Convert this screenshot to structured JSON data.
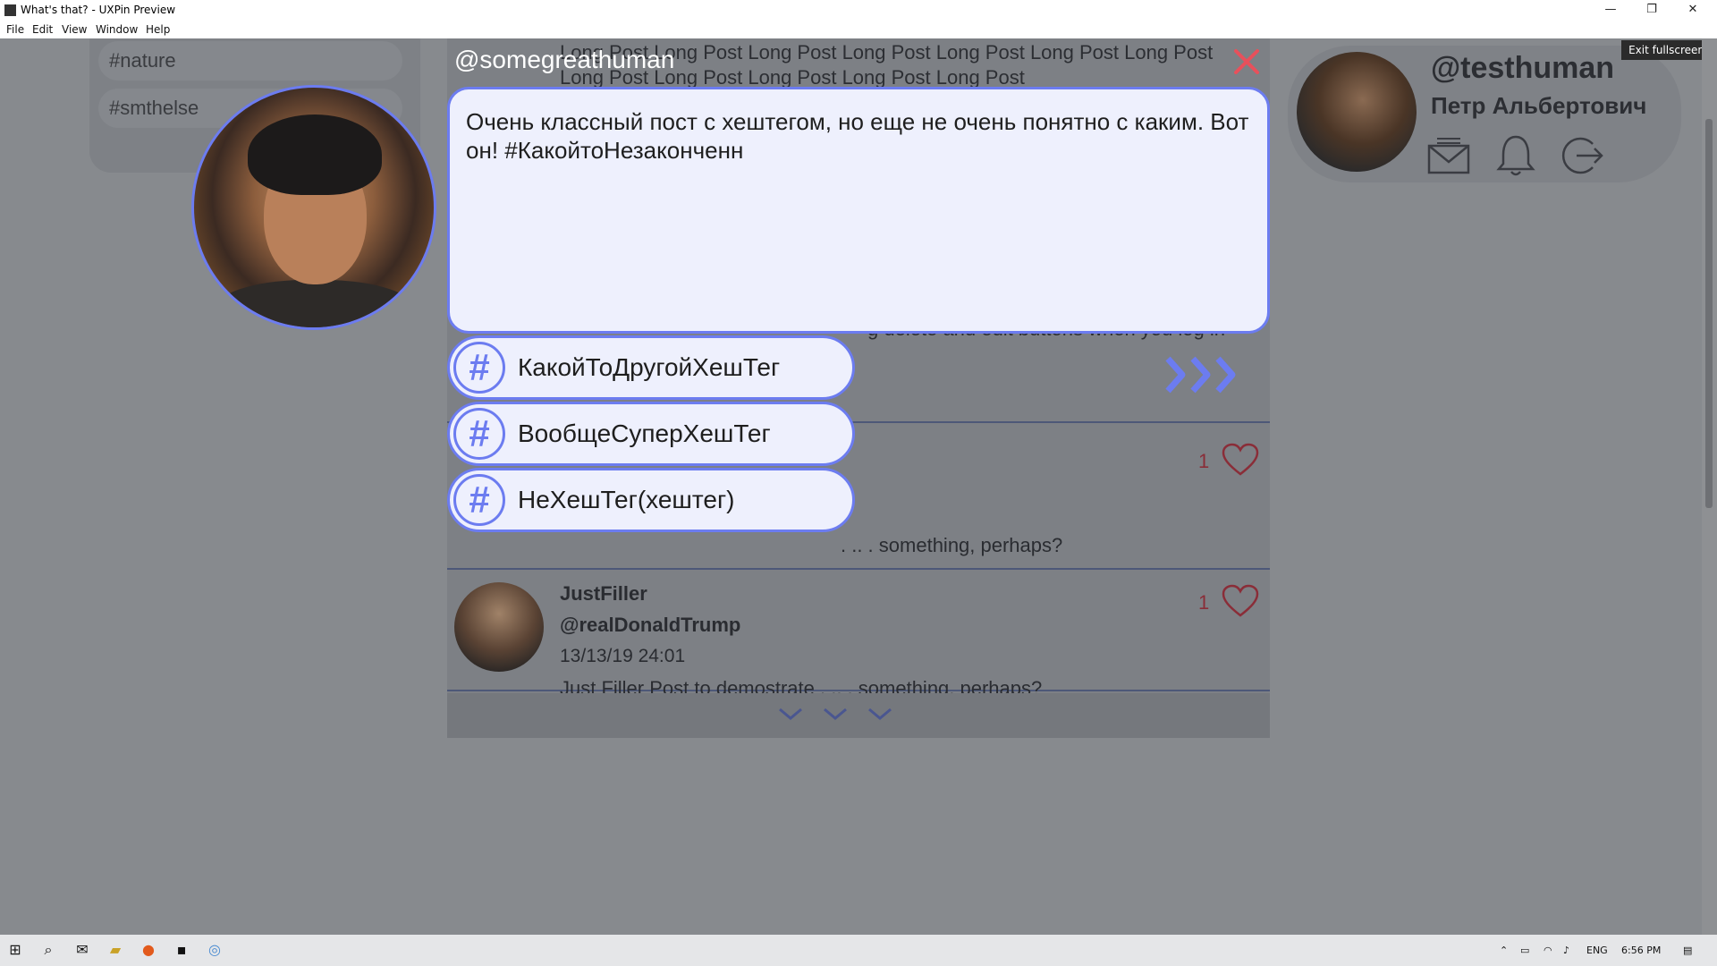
{
  "window": {
    "title": "What's that? - UXPin Preview",
    "minimize": "—",
    "restore": "❐",
    "close": "✕"
  },
  "menu": [
    "File",
    "Edit",
    "View",
    "Window",
    "Help"
  ],
  "exit_fullscreen": "Exit fullscreen",
  "sidebar": {
    "tags": [
      "#nature",
      "#smthelse"
    ]
  },
  "profile": {
    "handle": "@testhuman",
    "name": "Петр Альбертович",
    "icons": [
      "mail-icon",
      "bell-icon",
      "logout-icon"
    ]
  },
  "feed": {
    "background_text": "Long Post Long Post Long Post Long Post Long Post Long Post Long Post Long Post Long Post Long Post Long Post Long Post",
    "hidden_post_fragment": "g delete and edit buttons when you log in",
    "posts": [
      {
        "likes": "1",
        "body": ". .. . something, perhaps?"
      },
      {
        "author": "JustFiller",
        "handle": "@realDonaldTrump",
        "date": "13/13/19 24:01",
        "body": "Just Filler Post to demostrate . .. . something, perhaps?",
        "likes": "1"
      }
    ],
    "load_more_icon": "chevrons-down-icon"
  },
  "modal": {
    "handle": "@somegreathuman",
    "text": "Очень классный пост с хештегом, но еще не очень понятно с каким. Вот он! #КакойтоНезаконченн",
    "suggestions": [
      {
        "hash": "#",
        "label": "КакойТоДругойХешТег"
      },
      {
        "hash": "#",
        "label": "ВообщеСуперХешТег"
      },
      {
        "hash": "#",
        "label": "НеХешТег(хештег)"
      }
    ],
    "send_icon": "send-chevrons-icon",
    "close_icon": "close-icon"
  },
  "taskbar": {
    "lang": "ENG",
    "time": "6:56 PM"
  },
  "colors": {
    "accent": "#6c7cf0",
    "close_red": "#e8505b",
    "overlay_bg": "#878a8e",
    "modal_fill": "#eef0fd"
  }
}
